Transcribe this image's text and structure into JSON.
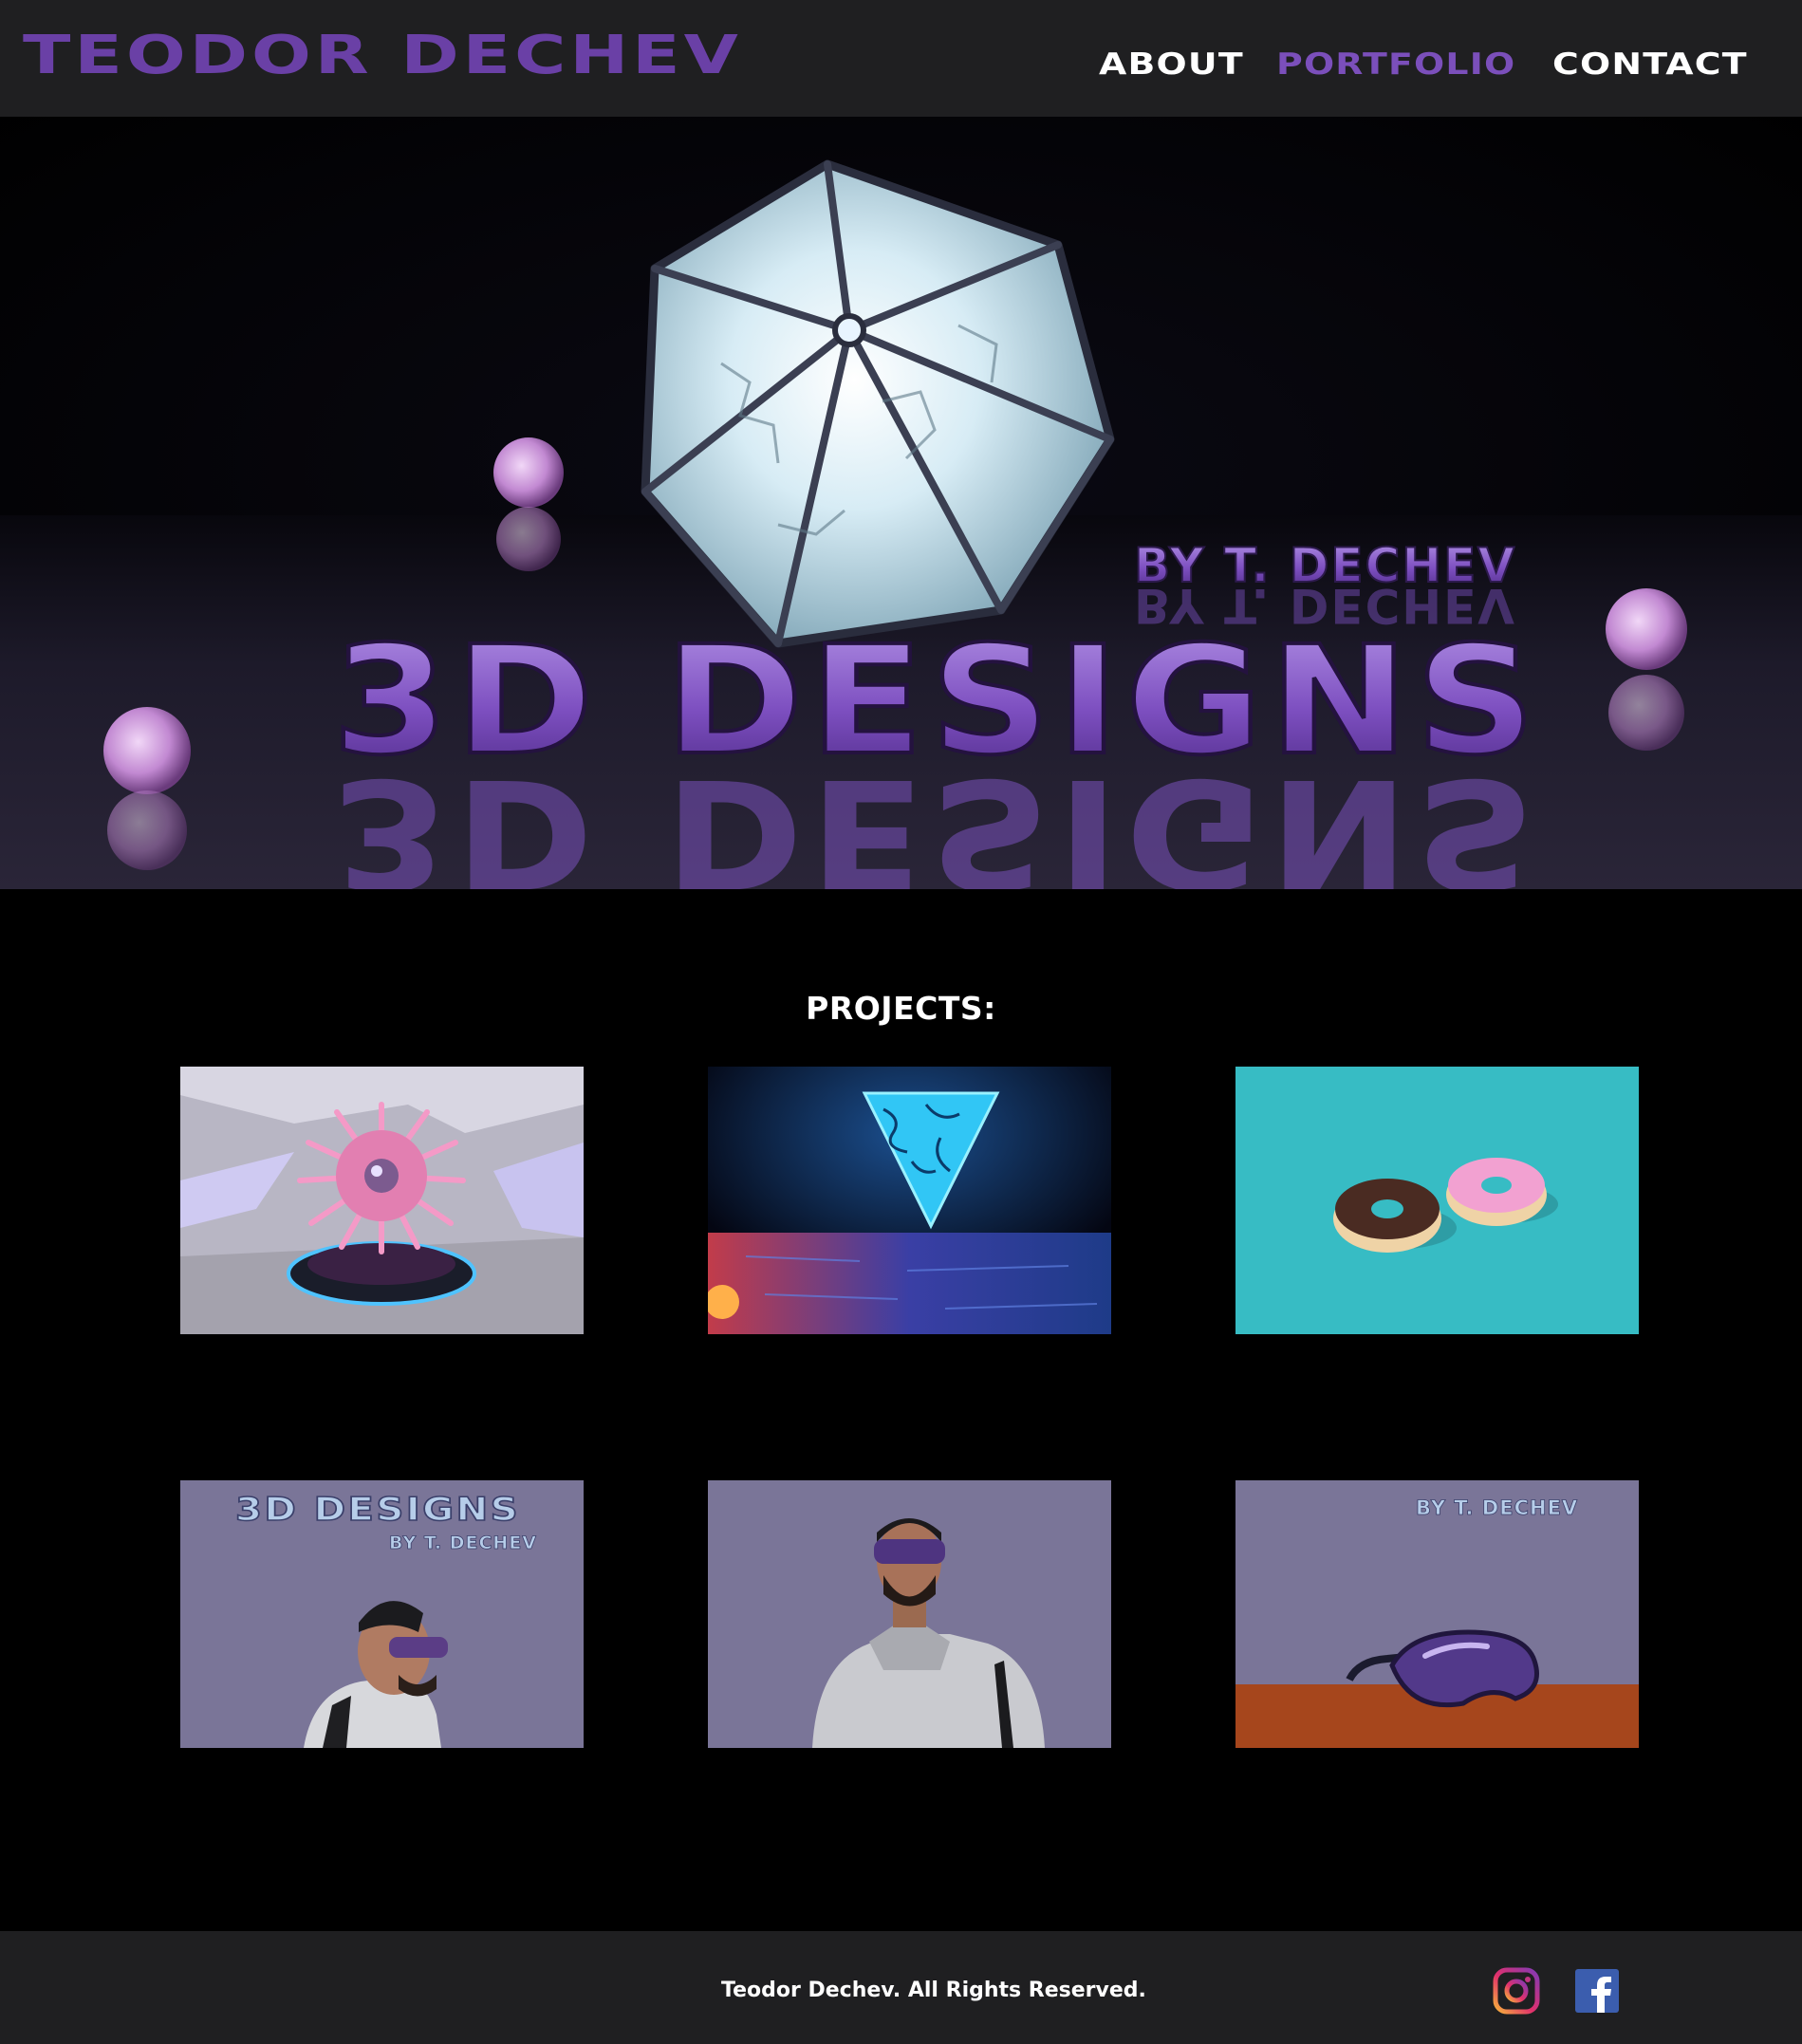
{
  "header": {
    "brand": "TEODOR DECHEV",
    "nav": [
      {
        "label": "ABOUT",
        "active": false
      },
      {
        "label": "PORTFOLIO",
        "active": true
      },
      {
        "label": "CONTACT",
        "active": false
      }
    ]
  },
  "hero": {
    "headline": "3D DESIGNS",
    "byline": "BY T. DECHEV"
  },
  "projects": {
    "title": "PROJECTS:",
    "items": [
      {
        "image": "pink-spiky-sphere-render"
      },
      {
        "image": "neon-triangle-ocean-render"
      },
      {
        "image": "donuts-render"
      },
      {
        "image": "character-profile-render",
        "caption": "3D DESIGNS",
        "subcaption": "BY T. DECHEV"
      },
      {
        "image": "character-front-render"
      },
      {
        "image": "goggles-render",
        "caption": "BY T. DECHEV"
      }
    ]
  },
  "footer": {
    "copyright": "Teodor Dechev. All Rights Reserved.",
    "social": [
      {
        "icon": "instagram-icon"
      },
      {
        "icon": "facebook-icon"
      }
    ]
  },
  "colors": {
    "header_bg": "#1f1f21",
    "brand_purple": "#6a40a6",
    "active_nav": "#7b4fbb",
    "page_bg": "#000000",
    "text": "#ffffff"
  }
}
